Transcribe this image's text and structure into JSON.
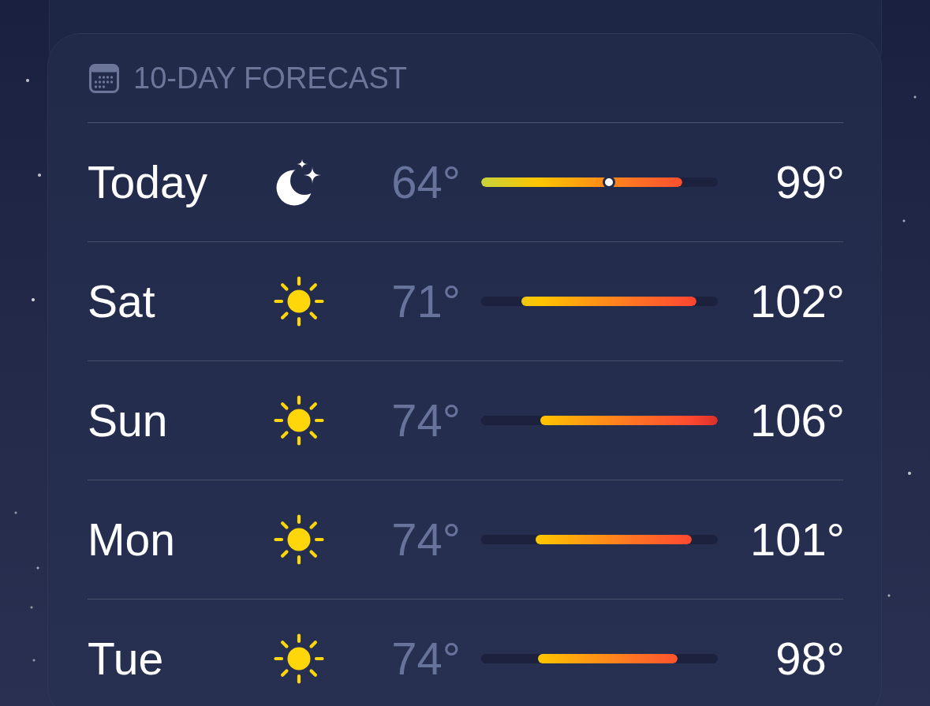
{
  "forecast": {
    "title": "10-DAY FORECAST",
    "days": [
      {
        "day": "Today",
        "kind": "clear_night",
        "low": "64°",
        "high": "99°",
        "bar": {
          "to": {
            "level": 0.85
          }
        },
        "current": {
          "level": 0.54
        }
      },
      {
        "day": "Sat",
        "kind": "sunny",
        "low": "71°",
        "high": "102°",
        "bar": {
          "from": {
            "level": 0.17
          },
          "to": {
            "level": 0.91
          }
        }
      },
      {
        "day": "Sun",
        "kind": "sunny",
        "low": "74°",
        "high": "106°",
        "bar": {
          "from": {
            "level": 0.25
          },
          "to": {
            "level": 1
          }
        }
      },
      {
        "day": "Mon",
        "kind": "sunny",
        "low": "74°",
        "high": "101°",
        "bar": {
          "from": {
            "level": 0.23
          },
          "to": {
            "level": 0.89
          }
        }
      },
      {
        "day": "Tue",
        "kind": "sunny",
        "low": "74°",
        "high": "98°",
        "bar": {
          "from": {
            "level": 0.24
          },
          "to": {
            "level": 0.83
          }
        }
      }
    ]
  }
}
